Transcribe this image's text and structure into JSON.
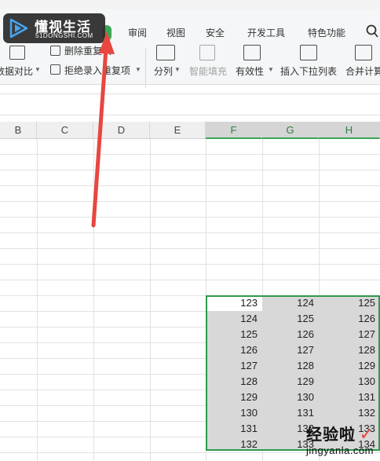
{
  "ribbon": {
    "tabs": [
      {
        "label": "审阅"
      },
      {
        "label": "视图"
      },
      {
        "label": "安全"
      },
      {
        "label": "开发工具"
      },
      {
        "label": "特色功能"
      }
    ],
    "active_tab_partial": "",
    "buttons": {
      "data_compare": "数据对比",
      "delete_duplicates": "删除重复项",
      "reject_duplicates": "拒绝录入重复项",
      "split_column": "分列",
      "smart_fill": "智能填充",
      "validation": "有效性",
      "insert_dropdown": "插入下拉列表",
      "consolidate": "合并计算"
    }
  },
  "grid": {
    "columns": [
      "B",
      "C",
      "D",
      "E",
      "F",
      "G",
      "H"
    ],
    "selected_columns": [
      "F",
      "G",
      "H"
    ],
    "rows": [
      [
        "123",
        "124",
        "125"
      ],
      [
        "124",
        "125",
        "126"
      ],
      [
        "125",
        "126",
        "127"
      ],
      [
        "126",
        "127",
        "128"
      ],
      [
        "127",
        "128",
        "129"
      ],
      [
        "128",
        "129",
        "130"
      ],
      [
        "129",
        "130",
        "131"
      ],
      [
        "130",
        "131",
        "132"
      ],
      [
        "131",
        "132",
        "133"
      ],
      [
        "132",
        "133",
        "134"
      ]
    ]
  },
  "logo": {
    "title": "懂视生活",
    "subtitle": "51DONGSHI.COM"
  },
  "watermark": {
    "title": "经验啦",
    "url": "jingyanla.com",
    "check": "✓"
  },
  "colors": {
    "accent": "#3aa657",
    "selection_border": "#2e9a4d",
    "arrow": "#e8463f"
  }
}
